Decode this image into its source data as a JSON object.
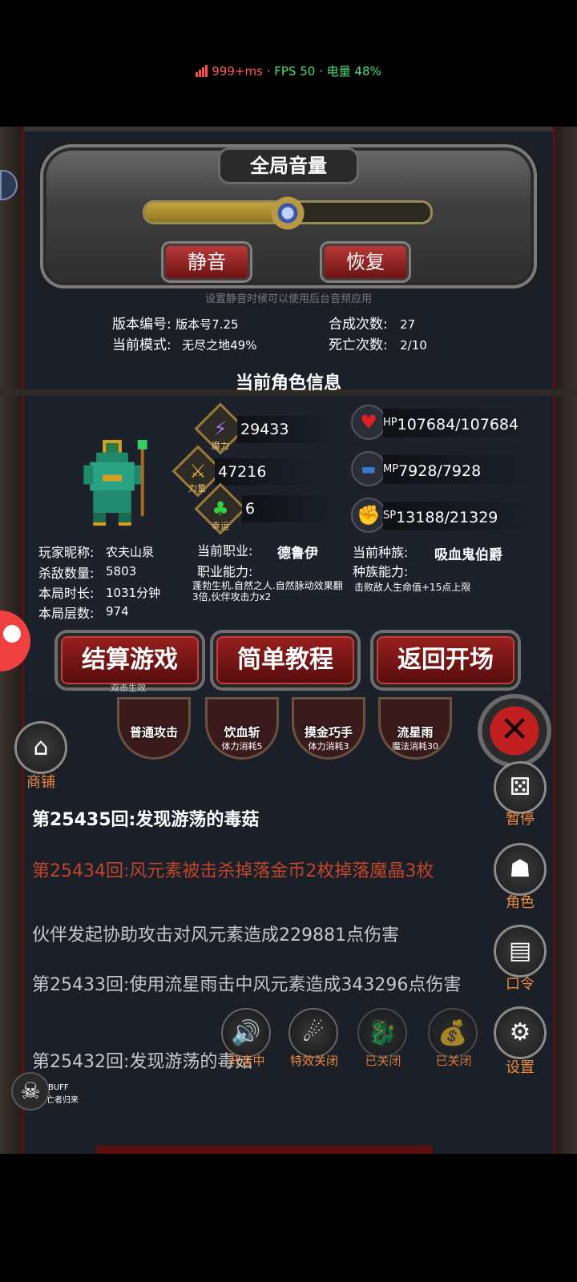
{
  "status_bar": {
    "latency": "999+ms",
    "sep1": "·",
    "fps": "FPS 50",
    "sep2": "·",
    "battery": "电量 48%"
  },
  "volume": {
    "title": "全局音量",
    "level_percent": 50,
    "mute_label": "静音",
    "restore_label": "恢复",
    "hint": "设置静音时候可以使用后台音频应用"
  },
  "info": {
    "version_label": "版本编号:",
    "version_value": "版本号7.25",
    "mode_label": "当前模式:",
    "mode_value": "无尽之地49%",
    "craft_label": "合成次数:",
    "craft_value": "27",
    "death_label": "死亡次数:",
    "death_value": "2/10"
  },
  "character": {
    "title": "当前角色信息",
    "stats": [
      {
        "icon": "lightning-icon",
        "label": "魔力",
        "value": "29433"
      },
      {
        "icon": "sword-icon",
        "label": "力量",
        "value": "47216"
      },
      {
        "icon": "clover-icon",
        "label": "幸运",
        "value": "6"
      }
    ],
    "resources": [
      {
        "icon": "heart-icon",
        "key": "HP",
        "value": "107684/107684"
      },
      {
        "icon": "car-icon",
        "key": "MP",
        "value": "7928/7928"
      },
      {
        "icon": "strength-icon",
        "key": "SP",
        "value": "13188/21329"
      }
    ],
    "nickname_label": "玩家昵称:",
    "nickname": "农夫山泉",
    "kills_label": "杀敌数量:",
    "kills": "5803",
    "duration_label": "本局时长:",
    "duration": "1031分钟",
    "floor_label": "本局层数:",
    "floor": "974",
    "job_label": "当前职业:",
    "job": "德鲁伊",
    "job_ability_label": "职业能力:",
    "job_ability": "蓬勃生机.自然之人.自然脉动效果翻3倍,伙伴攻击力x2",
    "race_label": "当前种族:",
    "race": "吸血鬼伯爵",
    "race_ability_label": "种族能力:",
    "race_ability": "击败敌人生命值+15点上限"
  },
  "actions": {
    "settle": "结算游戏",
    "settle_hint": "双击生效",
    "tutorial": "简单教程",
    "back": "返回开场"
  },
  "skills": [
    {
      "name": "普通攻击",
      "cost": ""
    },
    {
      "name": "饮血斩",
      "cost": "体力消耗5"
    },
    {
      "name": "摸金巧手",
      "cost": "体力消耗3"
    },
    {
      "name": "流星雨",
      "cost": "魔法消耗30"
    }
  ],
  "side": {
    "shop": "商铺",
    "pause": "暂停",
    "role": "角色",
    "code": "口令",
    "settings": "设置"
  },
  "log": [
    {
      "text": "第25435回:发现游荡的毒菇",
      "color": "#ffffff"
    },
    {
      "text": "第25434回:风元素被击杀掉落金币2枚掉落魔晶3枚",
      "color": "#c0452b"
    },
    {
      "text": "伙伴发起协助攻击对风元素造成229881点伤害",
      "color": "#c8c8c8"
    },
    {
      "text": "第25433回:使用流星雨击中风元素造成343296点伤害",
      "color": "#c8c8c8"
    },
    {
      "text": "第25432回:发现游荡的毒菇",
      "color": "#c8c8c8"
    }
  ],
  "toggles": {
    "sound": "开音中",
    "effects": "特效关闭",
    "t3": "已关闭",
    "t4": "已关闭"
  },
  "buff": {
    "label": "BUFF",
    "name": "亡者归来"
  }
}
